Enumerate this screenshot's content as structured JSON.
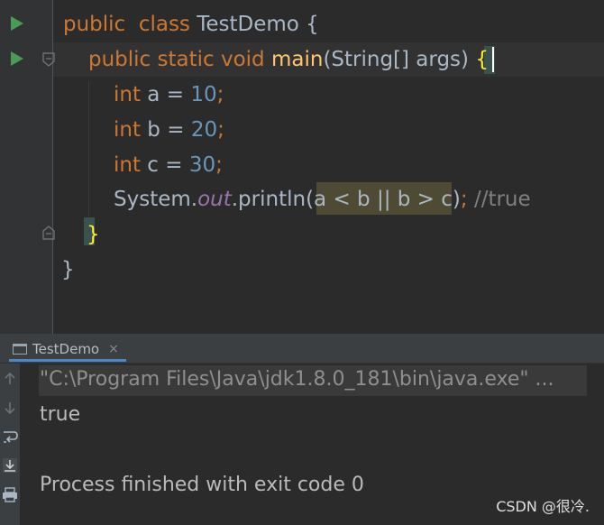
{
  "editor": {
    "lines": [
      {
        "t1": "public  class ",
        "t2": "TestDemo {"
      },
      {
        "k1": "public static void ",
        "fn": "main",
        "p": "(String[] args) ",
        "br": "{"
      },
      {
        "k": "int",
        "a": " a = ",
        "n": "10",
        "e": ";"
      },
      {
        "k": "int",
        "a": " b = ",
        "n": "20",
        "e": ";"
      },
      {
        "k": "int",
        "a": " c = ",
        "n": "30",
        "e": ";"
      },
      {
        "s1": "System.",
        "out": "out",
        "s2": ".println(",
        "expr": "a < b || b > c",
        "s3": ")",
        "semi": "; ",
        "cmt": "//true"
      },
      {
        "br": "}"
      },
      {
        "br": "}"
      }
    ],
    "icons": {
      "run": "run-arrow-icon",
      "fold": "fold-marker-icon"
    }
  },
  "run_panel": {
    "tab_label": "TestDemo",
    "tab_close": "×",
    "toolbar_icons": [
      "up-arrow-icon",
      "down-arrow-icon",
      "soft-wrap-icon",
      "scroll-to-end-icon",
      "print-icon"
    ],
    "console": {
      "command": "\"C:\\Program Files\\Java\\jdk1.8.0_181\\bin\\java.exe\" ...",
      "output": "true",
      "exit": "Process finished with exit code 0"
    }
  },
  "watermark": "CSDN @很冷."
}
